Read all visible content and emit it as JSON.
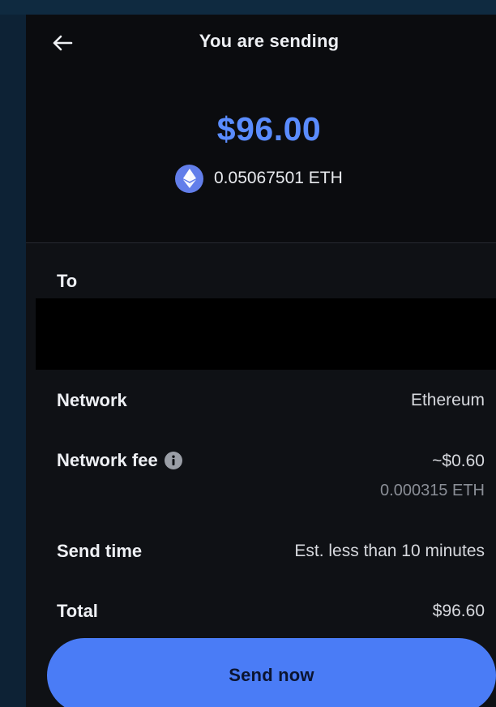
{
  "header": {
    "title": "You are sending"
  },
  "amount": {
    "fiat": "$96.00",
    "crypto_value": "0.05067501 ETH",
    "asset_icon": "ethereum-icon"
  },
  "recipient": {
    "label": "To"
  },
  "details": {
    "network_label": "Network",
    "network_value": "Ethereum",
    "fee_label": "Network fee",
    "fee_value": "~$0.60",
    "fee_crypto": "0.000315 ETH",
    "send_time_label": "Send time",
    "send_time_value": "Est. less than 10 minutes",
    "total_label": "Total",
    "total_value": "$96.60"
  },
  "actions": {
    "send_label": "Send now"
  },
  "colors": {
    "accent": "#5a8cff",
    "button": "#4a7cf6",
    "eth_badge": "#627eea",
    "background": "#0b0c0f"
  }
}
